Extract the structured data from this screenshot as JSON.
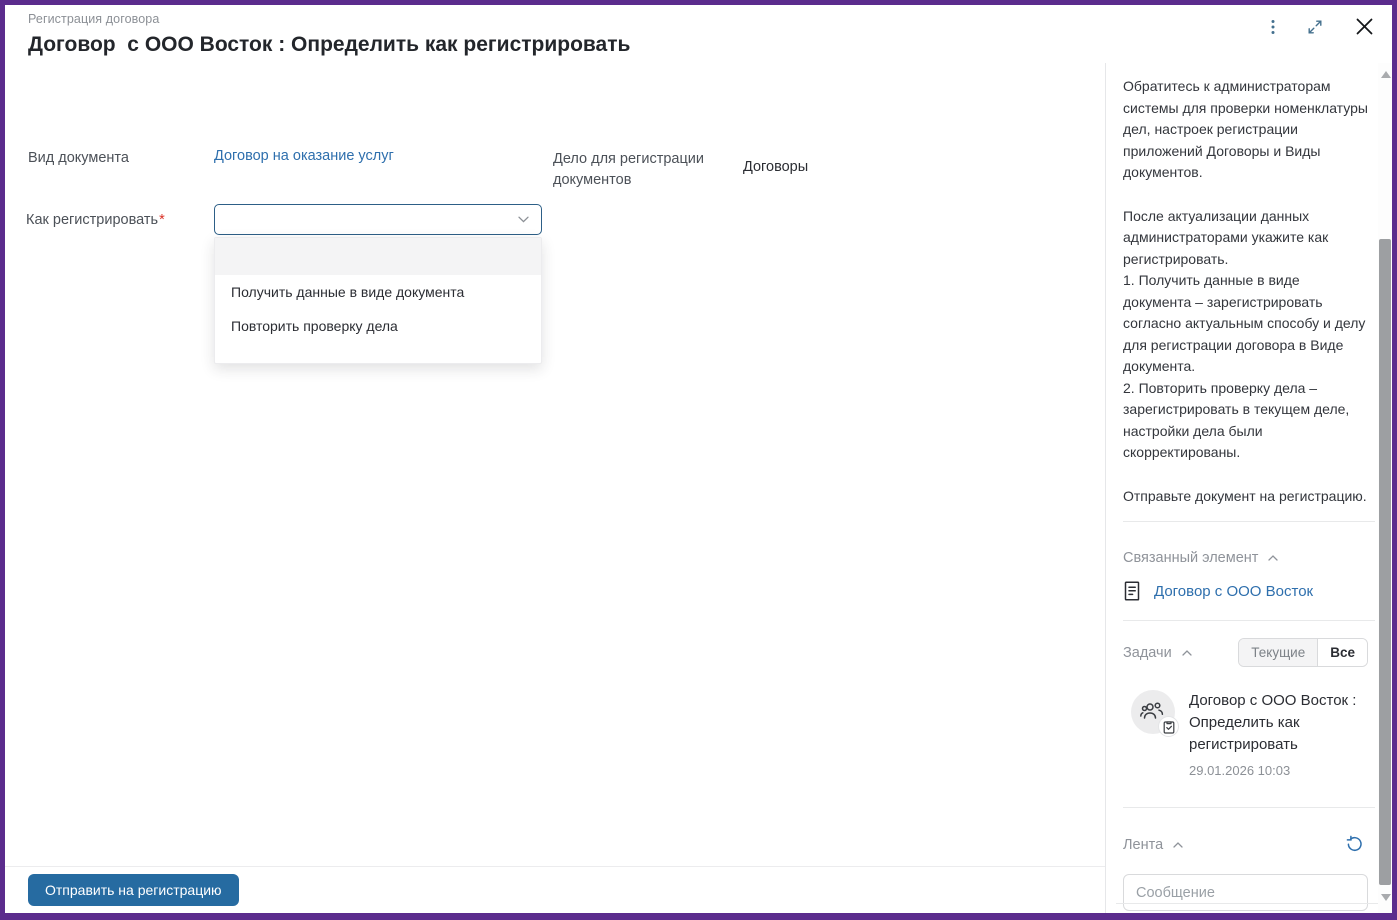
{
  "window": {
    "breadcrumb": "Регистрация договора",
    "title": "Договор  с ООО Восток : Определить как регистрировать"
  },
  "form": {
    "doc_type": {
      "label": "Вид документа",
      "value": "Договор на оказание услуг"
    },
    "case": {
      "label": "Дело для регистрации документов",
      "value": "Договоры"
    },
    "how_register": {
      "label": "Как регистрировать",
      "required_mark": "*",
      "selected_value": ""
    },
    "dropdown_options": [
      "",
      "Получить данные в виде документа",
      "Повторить проверку дела"
    ]
  },
  "footer": {
    "submit_label": "Отправить на регистрацию"
  },
  "sidebar": {
    "help": {
      "p1": "Обратитесь к администраторам системы для проверки номенклатуры дел, настроек регистрации приложений Договоры и Виды документов.",
      "p2": "После актуализации данных администраторами укажите как регистрировать.",
      "p3": "1. Получить данные в виде документа – зарегистрировать согласно актуальным способу и делу для регистрации договора в Виде документа.",
      "p4": "2. Повторить проверку дела – зарегистрировать в текущем деле, настройки дела были скорректированы.",
      "p5": "Отправьте документ на регистрацию."
    },
    "related": {
      "title": "Связанный элемент",
      "link": "Договор с ООО Восток"
    },
    "tasks": {
      "title": "Задачи",
      "filter_current": "Текущие",
      "filter_all": "Все",
      "task": {
        "title": "Договор с ООО Восток : Определить как регистрировать",
        "timestamp": "29.01.2026 10:03"
      }
    },
    "feed": {
      "title": "Лента",
      "message_placeholder": "Сообщение"
    }
  },
  "colors": {
    "accent_purple": "#5b2c8d",
    "link_blue": "#2e6fad",
    "button_blue": "#266ba1",
    "select_border": "#2d5f87"
  }
}
